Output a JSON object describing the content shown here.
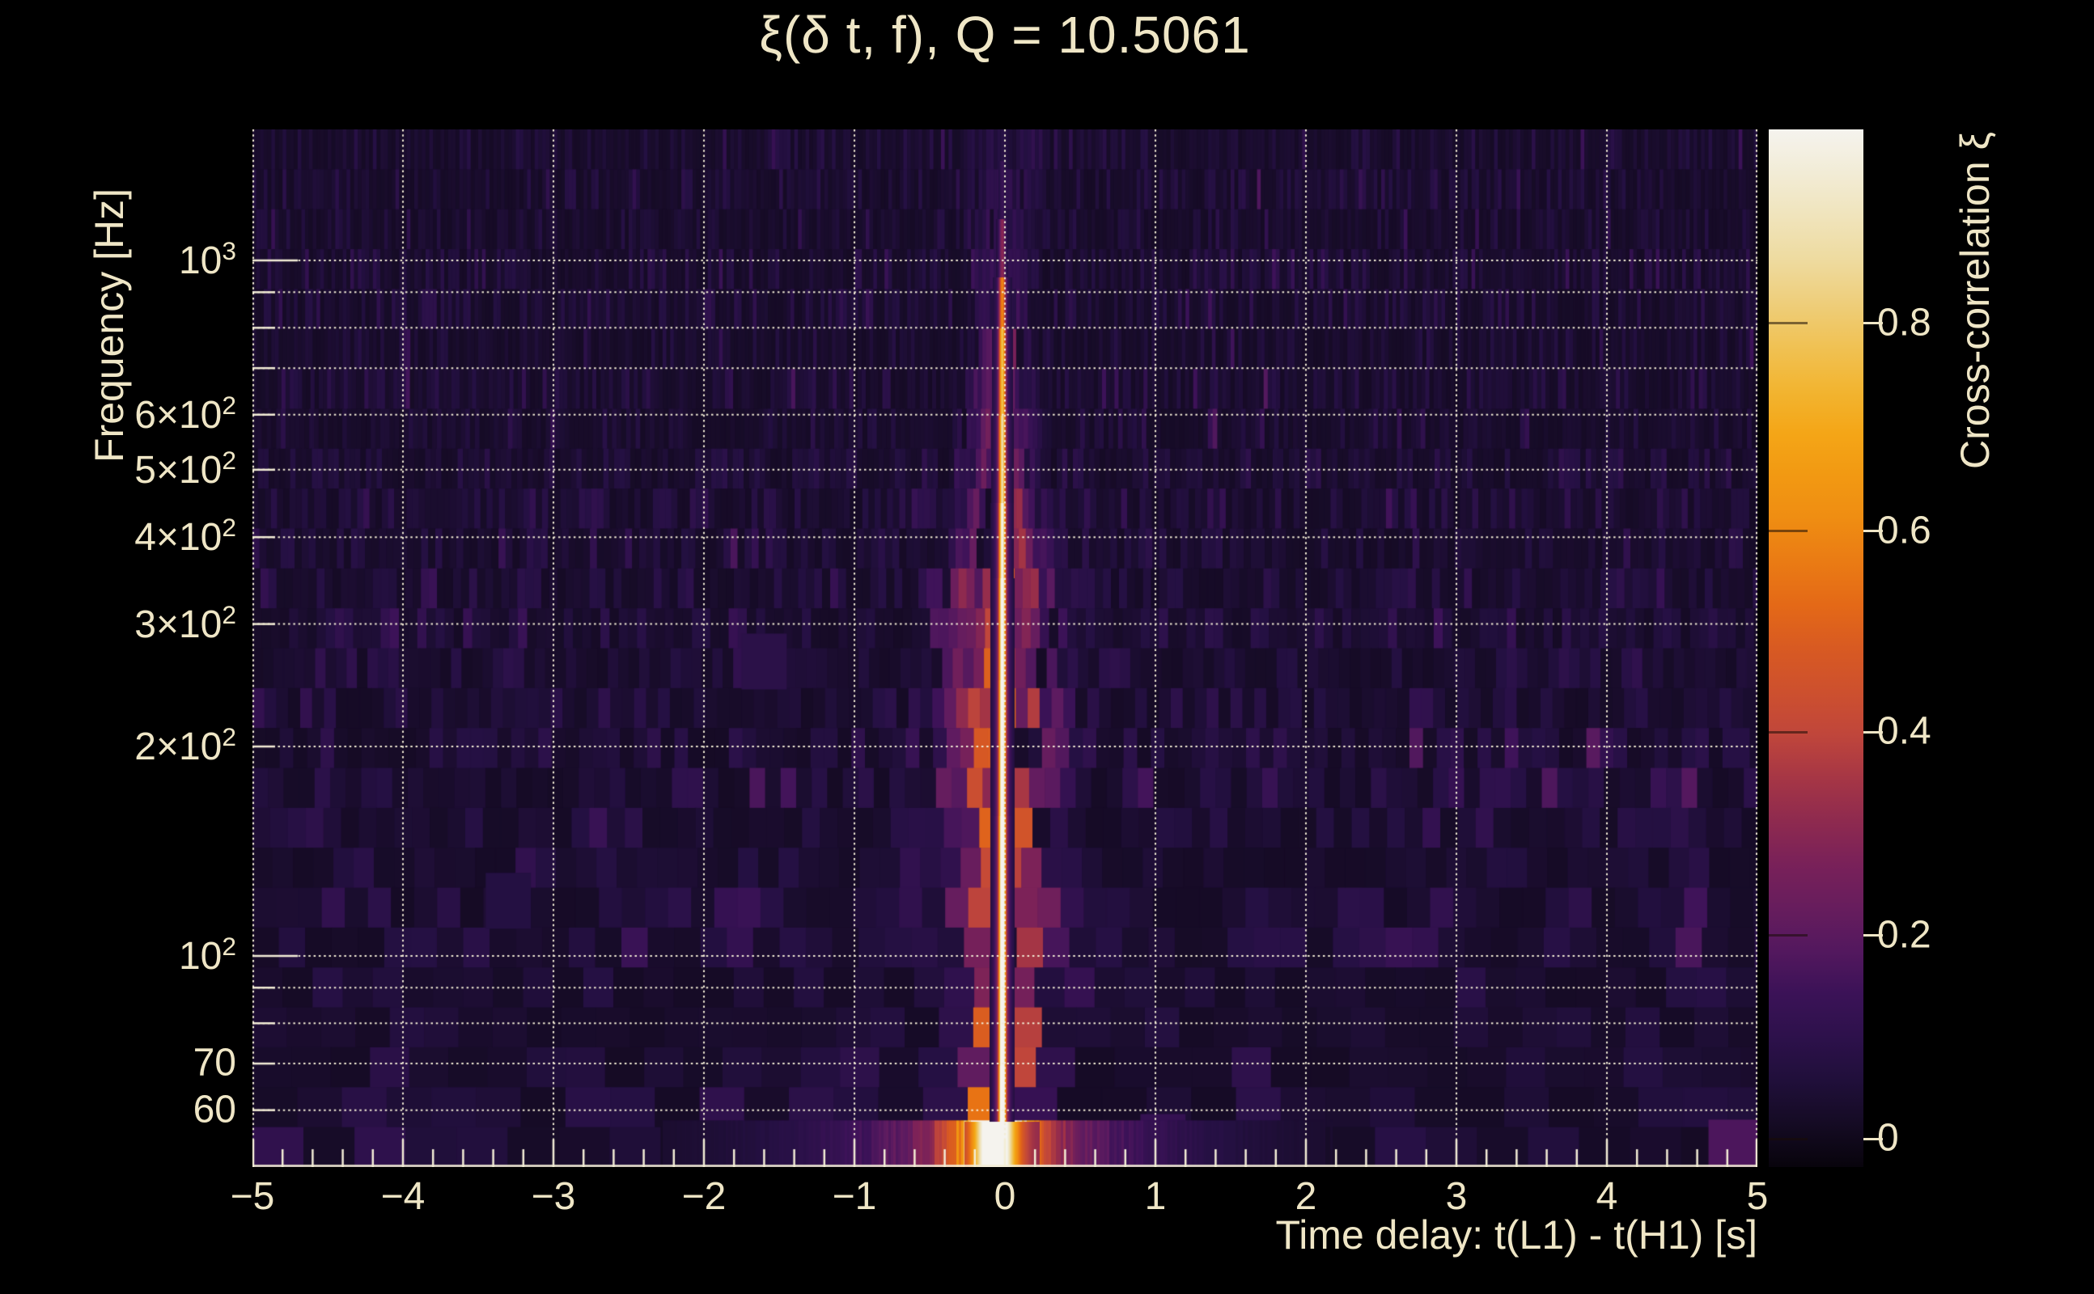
{
  "title": "ξ(δ t, f), Q = 10.5061",
  "plot": {
    "x_axis": {
      "label": "Time delay: t(L1) - t(H1) [s]",
      "range_s": [
        -5,
        5
      ],
      "ticks": [
        {
          "v": -5,
          "label": "−5"
        },
        {
          "v": -4,
          "label": "−4"
        },
        {
          "v": -3,
          "label": "−3"
        },
        {
          "v": -2,
          "label": "−2"
        },
        {
          "v": -1,
          "label": "−1"
        },
        {
          "v": 0,
          "label": "0"
        },
        {
          "v": 1,
          "label": "1"
        },
        {
          "v": 2,
          "label": "2"
        },
        {
          "v": 3,
          "label": "3"
        },
        {
          "v": 4,
          "label": "4"
        },
        {
          "v": 5,
          "label": "5"
        }
      ],
      "minor_step_s": 0.2
    },
    "y_axis": {
      "label": "Frequency [Hz]",
      "scale": "log",
      "range_hz": [
        49.7,
        1543
      ],
      "ticks": [
        {
          "f": 1000,
          "mant": "10",
          "sup": "3"
        },
        {
          "f": 600,
          "mant": "6×10",
          "sup": "2"
        },
        {
          "f": 500,
          "mant": "5×10",
          "sup": "2"
        },
        {
          "f": 400,
          "mant": "4×10",
          "sup": "2"
        },
        {
          "f": 300,
          "mant": "3×10",
          "sup": "2"
        },
        {
          "f": 200,
          "mant": "2×10",
          "sup": "2"
        },
        {
          "f": 100,
          "mant": "10",
          "sup": "2"
        },
        {
          "f": 70,
          "mant": "70",
          "sup": ""
        },
        {
          "f": 60,
          "mant": "60",
          "sup": ""
        }
      ],
      "grid_hz": [
        60,
        70,
        80,
        90,
        100,
        200,
        300,
        400,
        500,
        600,
        700,
        800,
        900,
        1000
      ]
    }
  },
  "colorbar": {
    "label": "Cross-correlation ξ",
    "ticks": [
      {
        "value": "0.8",
        "frac": 0.187
      },
      {
        "value": "0.6",
        "frac": 0.387
      },
      {
        "value": "0.4",
        "frac": 0.581
      },
      {
        "value": "0.2",
        "frac": 0.777
      },
      {
        "value": "0",
        "frac": 0.973
      }
    ]
  },
  "colors": {
    "background": "#000000",
    "text": "#efe6c6",
    "grid": "#f3edd6",
    "axis": "#f3edd6",
    "colormap": [
      [
        0.0,
        "#08040c"
      ],
      [
        0.03,
        "#120a1e"
      ],
      [
        0.1,
        "#251043"
      ],
      [
        0.17,
        "#3c1258"
      ],
      [
        0.225,
        "#5d1b60"
      ],
      [
        0.3,
        "#7c2258"
      ],
      [
        0.36,
        "#9c3048"
      ],
      [
        0.42,
        "#c2473a"
      ],
      [
        0.5,
        "#d85a22"
      ],
      [
        0.55,
        "#e66c15"
      ],
      [
        0.617,
        "#ef8b12"
      ],
      [
        0.7,
        "#f4a312"
      ],
      [
        0.76,
        "#f2b838"
      ],
      [
        0.813,
        "#eec869"
      ],
      [
        0.88,
        "#eedca4"
      ],
      [
        0.94,
        "#f1e9cc"
      ],
      [
        1.0,
        "#f5f3ee"
      ]
    ]
  },
  "chart_data": {
    "type": "heatmap",
    "title": "ξ(δ t, f), Q = 10.5061",
    "q_value": 10.5061,
    "xlabel": "Time delay: t(L1) - t(H1) [s]",
    "ylabel": "Frequency [Hz]",
    "x_range_s": [
      -5,
      5
    ],
    "y_range_hz": [
      49.7,
      1543
    ],
    "y_scale": "log",
    "color_range_xi": [
      -0.03,
      0.99
    ],
    "colorbar_tick_values": [
      0,
      0.2,
      0.4,
      0.6,
      0.8
    ],
    "peak": {
      "time_delay_s": -0.02,
      "xi_max": 0.97,
      "freq_extent_hz": [
        50,
        1100
      ]
    },
    "signal": {
      "t0_s": -0.02,
      "core_sigma_s": 0.021,
      "glow_sigma_s": 0.062,
      "bands": [
        {
          "f_lo": 49.7,
          "f_hi": 58,
          "core": 0.97,
          "wing_hw_s": 0.3,
          "wing": 0.55
        },
        {
          "f_lo": 58,
          "f_hi": 70,
          "core": 0.97,
          "wing_hw_s": 0.26,
          "wing": 0.5
        },
        {
          "f_lo": 70,
          "f_hi": 100,
          "core": 0.93,
          "wing_hw_s": 0.22,
          "wing": 0.45
        },
        {
          "f_lo": 100,
          "f_hi": 160,
          "core": 0.88,
          "wing_hw_s": 0.33,
          "wing": 0.4
        },
        {
          "f_lo": 160,
          "f_hi": 250,
          "core": 0.84,
          "wing_hw_s": 0.38,
          "wing": 0.42
        },
        {
          "f_lo": 250,
          "f_hi": 350,
          "core": 0.8,
          "wing_hw_s": 0.34,
          "wing": 0.36
        },
        {
          "f_lo": 350,
          "f_hi": 450,
          "core": 0.74,
          "wing_hw_s": 0.28,
          "wing": 0.3
        },
        {
          "f_lo": 450,
          "f_hi": 600,
          "core": 0.66,
          "wing_hw_s": 0.21,
          "wing": 0.24
        },
        {
          "f_lo": 600,
          "f_hi": 800,
          "core": 0.58,
          "wing_hw_s": 0.17,
          "wing": 0.18
        },
        {
          "f_lo": 800,
          "f_hi": 950,
          "core": 0.44,
          "wing_hw_s": 0.15,
          "wing": 0.14
        },
        {
          "f_lo": 950,
          "f_hi": 1150,
          "core": 0.22,
          "wing_hw_s": 0.19,
          "wing": 0.11
        },
        {
          "f_lo": 1150,
          "f_hi": 1400,
          "core": 0.09,
          "wing_hw_s": 0.28,
          "wing": 0.08
        },
        {
          "f_lo": 1400,
          "f_hi": 1543,
          "core": 0.05,
          "wing_hw_s": 0.3,
          "wing": 0.05
        }
      ],
      "bottom_band": {
        "f_max_hz": 58,
        "center_t_s": -0.07,
        "blob_xi": 0.95,
        "blob_sigma_s": 0.14,
        "mid_xi": 0.5,
        "mid_sigma_s": 0.33,
        "tail_xi": 0.3,
        "tail_sigma_s": 1.0,
        "tail_exp": 1.4
      },
      "hot_spots": [
        {
          "t": 4.85,
          "f": 53,
          "xi": 0.17,
          "w_s": 0.35
        },
        {
          "t": 1.05,
          "f": 54,
          "xi": 0.12,
          "w_s": 0.3
        },
        {
          "t": -1.6,
          "f": 265,
          "xi": 0.09,
          "w_s": 0.3
        },
        {
          "t": -3.3,
          "f": 120,
          "xi": 0.07,
          "w_s": 0.3
        }
      ]
    },
    "noise": {
      "base_xi": 0.015,
      "spread_xi": 0.05,
      "spike_prob": 0.04,
      "rows": 26,
      "tile_time_const": 18,
      "tile_w_range_s": [
        0.025,
        0.5
      ],
      "seed": 1337
    },
    "legend_position": "right-colorbar",
    "grid": "dotted-cream-on-all-decade-and-integer-lines"
  }
}
